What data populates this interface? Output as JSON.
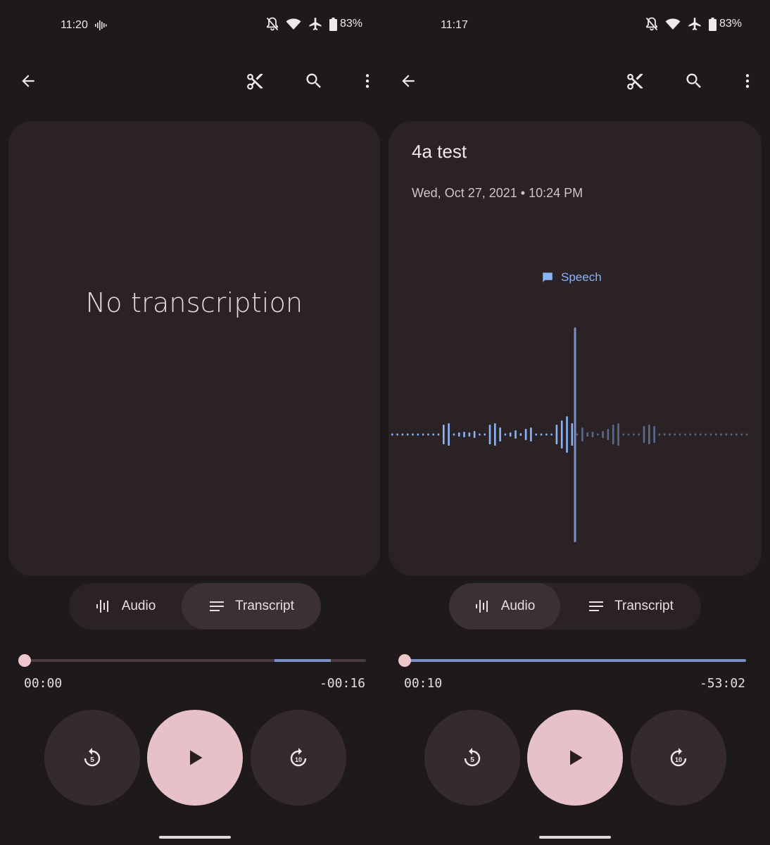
{
  "left": {
    "status": {
      "time": "11:20",
      "battery": "83%"
    },
    "card": {
      "empty_text": "No transcription"
    },
    "toggle": {
      "audio_label": "Audio",
      "transcript_label": "Transcript",
      "active": "transcript"
    },
    "player": {
      "elapsed": "00:00",
      "remaining": "-00:16",
      "progress": 0.0
    },
    "controls": {
      "rewind": "5",
      "forward": "10"
    }
  },
  "right": {
    "status": {
      "time": "11:17",
      "battery": "83%"
    },
    "card": {
      "title": "4a test",
      "date": "Wed, Oct 27, 2021 • 10:24 PM",
      "marker_label": "Speech"
    },
    "toggle": {
      "audio_label": "Audio",
      "transcript_label": "Transcript",
      "active": "audio"
    },
    "player": {
      "elapsed": "00:10",
      "remaining": "-53:02",
      "progress": 0.0
    },
    "controls": {
      "rewind": "5",
      "forward": "10"
    }
  },
  "icons": {
    "back": "arrow-back-icon",
    "trim": "scissors-icon",
    "search": "search-icon",
    "more": "more-vert-icon",
    "audio": "graphic-eq-icon",
    "transcript": "notes-icon",
    "play": "play-icon",
    "replay": "replay-5-icon",
    "forward": "forward-10-icon",
    "speech": "chat-bubble-icon"
  },
  "colors": {
    "background": "#1e1a1b",
    "card": "#2b2225",
    "accent_pink": "#e6c2c8",
    "accent_blue": "#8ab4f8",
    "waveform_past": "#8ab4f8",
    "waveform_future": "#5a6a8a"
  }
}
